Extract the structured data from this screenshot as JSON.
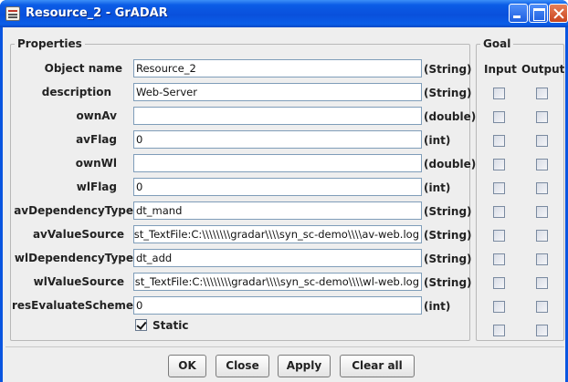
{
  "window": {
    "title": "Resource_2 - GrADAR"
  },
  "properties": {
    "group_title": "Properties",
    "rows": [
      {
        "label": "Object name",
        "value": "Resource_2",
        "type": "(String)"
      },
      {
        "label": "description",
        "value": "Web-Server",
        "type": "(String)"
      },
      {
        "label": "ownAv",
        "value": "",
        "type": "(double)"
      },
      {
        "label": "avFlag",
        "value": "0",
        "type": "(int)"
      },
      {
        "label": "ownWl",
        "value": "",
        "type": "(double)"
      },
      {
        "label": "wlFlag",
        "value": "0",
        "type": "(int)"
      },
      {
        "label": "avDependencyType",
        "value": "dt_mand",
        "type": "(String)"
      },
      {
        "label": "avValueSource",
        "value": "vst_TextFile:C:\\\\\\\\\\\\\\\\gradar\\\\\\\\syn_sc-demo\\\\\\\\av-web.log",
        "type": "(String)"
      },
      {
        "label": "wlDependencyType",
        "value": "dt_add",
        "type": "(String)"
      },
      {
        "label": "wlValueSource",
        "value": "vst_TextFile:C:\\\\\\\\\\\\\\\\gradar\\\\\\\\syn_sc-demo\\\\\\\\wl-web.log",
        "type": "(String)"
      },
      {
        "label": "resEvaluateScheme",
        "value": "0",
        "type": "(int)"
      }
    ],
    "static_label": "Static",
    "static_checked": true
  },
  "goal": {
    "group_title": "Goal",
    "input_label": "Input",
    "output_label": "Output"
  },
  "buttons": {
    "ok": "OK",
    "close": "Close",
    "apply": "Apply",
    "clear_all": "Clear all"
  }
}
